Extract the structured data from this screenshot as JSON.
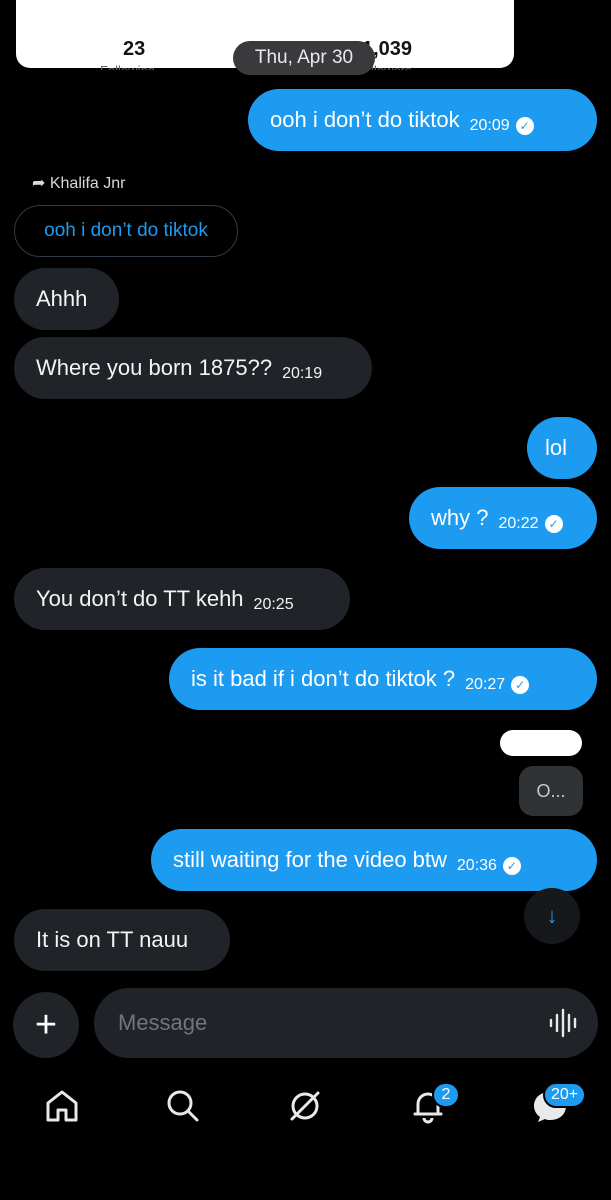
{
  "profile": {
    "following_count": "23",
    "following_label": "Following",
    "followers_count": "1,039",
    "followers_label": "Followers"
  },
  "date_separator": "Thu, Apr 30",
  "messages": [
    {
      "text": "ooh i don’t do tiktok",
      "time": "20:09"
    },
    {
      "text": "Ahhh"
    },
    {
      "text": "Where you born 1875??",
      "time": "20:19"
    },
    {
      "text": "lol"
    },
    {
      "text": "why ?",
      "time": "20:22"
    },
    {
      "text": "You don’t do TT kehh",
      "time": "20:25"
    },
    {
      "text": "is it bad if i don’t do tiktok ?",
      "time": "20:27"
    },
    {
      "text": "still waiting for the video btw",
      "time": "20:36"
    },
    {
      "text": "It is on TT nauu"
    }
  ],
  "reply": {
    "to_name": "Khalifa Jnr",
    "quoted_text": "ooh i don’t do tiktok",
    "small_bubble_text": "O..."
  },
  "composer": {
    "placeholder": "Message"
  },
  "nav": {
    "notifications_badge": "2",
    "messages_badge": "20+"
  },
  "colors": {
    "accent": "#1d9bf0",
    "received_bubble": "#202327",
    "background": "#000000"
  }
}
